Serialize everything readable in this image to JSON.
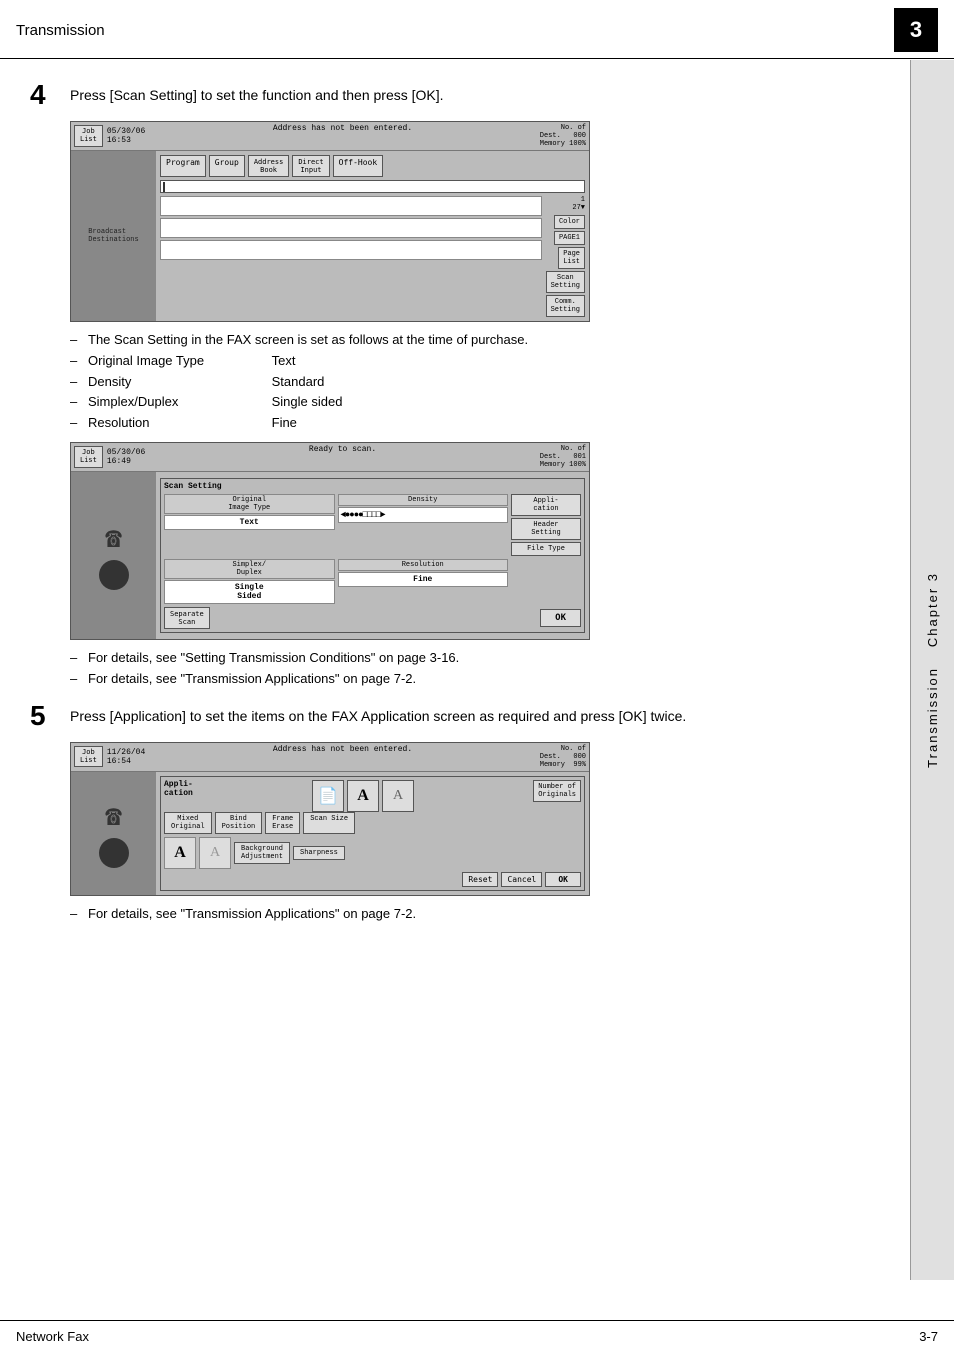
{
  "header": {
    "title": "Transmission",
    "chapter_number": "3"
  },
  "sidebar": {
    "chapter_label": "Chapter 3",
    "section_label": "Transmission"
  },
  "step4": {
    "number": "4",
    "text": "Press [Scan Setting] to set the function and then press [OK]."
  },
  "fax_screen1": {
    "job_list": "Job\nList",
    "date_time": "05/30/06\n16:53",
    "status": "Address has not been entered.",
    "dest_label": "No. of\nDest.",
    "dest_value": "000",
    "memory": "Memory 100%",
    "broadcast": "Broadcast\nDestinations",
    "buttons": [
      "Program",
      "Group",
      "Address\nBook",
      "Direct\nInput",
      "Off-Hook"
    ],
    "right_buttons": [
      "Color",
      "PAGE1",
      "Page\nList",
      "Scan\nSetting",
      "Comm.\nSetting"
    ]
  },
  "bullets1": [
    {
      "text": "The Scan Setting in the FAX screen is set as follows at the time of purchase."
    },
    {
      "label": "Original Image Type",
      "value": "Text"
    },
    {
      "label": "Density",
      "value": "Standard"
    },
    {
      "label": "Simplex/Duplex",
      "value": "Single sided"
    },
    {
      "label": "Resolution",
      "value": "Fine"
    }
  ],
  "fax_screen2": {
    "job_list": "Job\nList",
    "date_time": "05/30/06\n16:49",
    "status": "Ready to scan.",
    "dest_label": "No. of\nDest.",
    "dest_value": "001",
    "memory": "Memory 100%",
    "scan_setting_title": "Scan Setting",
    "original_type_label": "Original\nImage Type",
    "original_type_value": "Text",
    "density_label": "Density",
    "density_value": "◄●●●●□□□□►",
    "simplex_label": "Simplex/\nDuplex",
    "simplex_value": "Single\nSided",
    "resolution_label": "Resolution",
    "resolution_value": "Fine",
    "separate_scan": "Separate\nScan",
    "ok_btn": "OK",
    "right_buttons": [
      "Appli-\ncation",
      "Header\nSetting",
      "File Type"
    ]
  },
  "bullets2": [
    {
      "text": "For details, see \"Setting Transmission Conditions\" on page 3-16."
    },
    {
      "text": "For details, see \"Transmission Applications\" on page 7-2."
    }
  ],
  "step5": {
    "number": "5",
    "text": "Press [Application] to set the items on the FAX Application screen as required and press [OK] twice."
  },
  "fax_screen3": {
    "job_list": "Job\nList",
    "date_time": "11/26/04\n16:54",
    "status": "Address has not been entered.",
    "dest_label": "No. of\nDest.",
    "dest_value": "000",
    "memory": "Memory  99%",
    "app_title": "Appli-\ncation",
    "icons": [
      "📄",
      "A",
      "A"
    ],
    "btn1": "Mixed\nOriginal",
    "btn2": "Bind\nPosition",
    "btn3": "Frame\nErase",
    "btn4": "Scan Size",
    "btn5": "Background\nAdjustment",
    "btn6": "Sharpness",
    "reset": "Reset",
    "cancel": "Cancel",
    "ok": "OK"
  },
  "bullets3": [
    {
      "text": "For details, see \"Transmission Applications\" on page 7-2."
    }
  ],
  "footer": {
    "left": "Network Fax",
    "right": "3-7"
  }
}
